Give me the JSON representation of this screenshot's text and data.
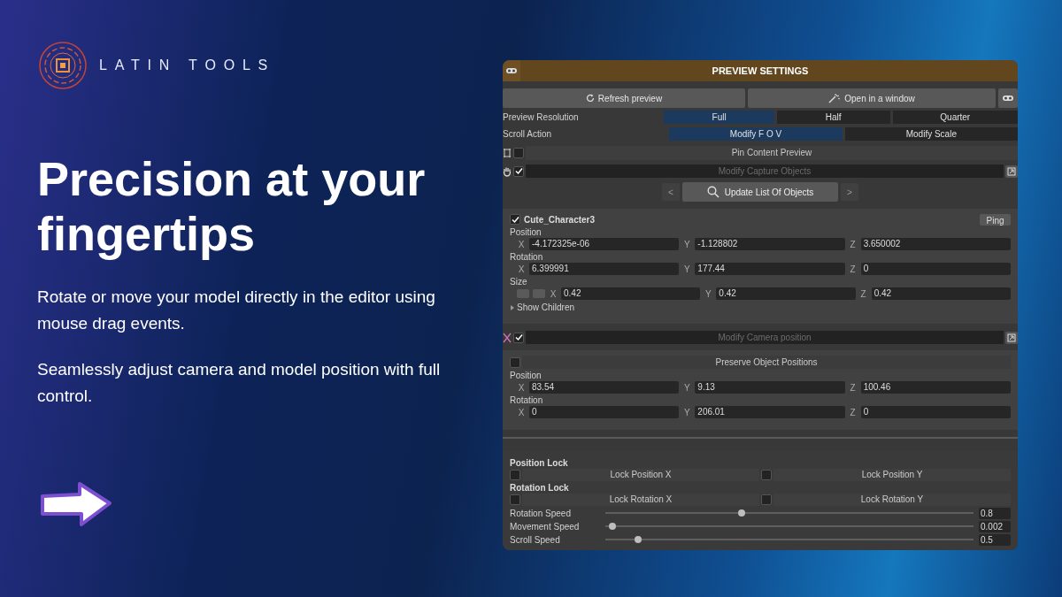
{
  "brand": "LATIN TOOLS",
  "headline": "Precision at your fingertips",
  "paragraphs": [
    "Rotate or move your model directly in the editor using mouse drag events.",
    "Seamlessly adjust camera and model position with full control."
  ],
  "panel": {
    "title": "PREVIEW SETTINGS",
    "refresh_button": "Refresh preview",
    "open_button": "Open in a window",
    "resolution": {
      "label": "Preview Resolution",
      "options": [
        {
          "label": "Full",
          "selected": true
        },
        {
          "label": "Half",
          "selected": false
        },
        {
          "label": "Quarter",
          "selected": false
        }
      ]
    },
    "scroll_action": {
      "label": "Scroll Action",
      "options": [
        {
          "label": "Modify F O V",
          "selected": true
        },
        {
          "label": "Modify Scale",
          "selected": false
        }
      ]
    },
    "pin": {
      "label": "Pin Content Preview",
      "checked": false
    },
    "capture": {
      "label": "Modify Capture Objects",
      "checked": true
    },
    "nav": {
      "prev": "<",
      "button": "Update List Of Objects",
      "next": ">"
    },
    "object": {
      "name": "Cute_Character3",
      "checked": true,
      "ping": "Ping",
      "groups": [
        {
          "label": "Position",
          "fields": [
            {
              "axis": "X",
              "value": "-4.172325e-06"
            },
            {
              "axis": "Y",
              "value": "-1.128802"
            },
            {
              "axis": "Z",
              "value": "3.650002"
            }
          ]
        },
        {
          "label": "Rotation",
          "fields": [
            {
              "axis": "X",
              "value": "6.399991"
            },
            {
              "axis": "Y",
              "value": "177.44"
            },
            {
              "axis": "Z",
              "value": "0"
            }
          ]
        },
        {
          "label": "Size",
          "kind": "size",
          "fields": [
            {
              "axis": "X",
              "value": "0.42"
            },
            {
              "axis": "Y",
              "value": "0.42"
            },
            {
              "axis": "Z",
              "value": "0.42"
            }
          ]
        }
      ],
      "show_children": "Show Children"
    },
    "camera": {
      "label": "Modify Camera position",
      "checked": true,
      "preserve": {
        "label": "Preserve Object Positions",
        "checked": false
      },
      "groups": [
        {
          "label": "Position",
          "fields": [
            {
              "axis": "X",
              "value": "83.54"
            },
            {
              "axis": "Y",
              "value": "9.13"
            },
            {
              "axis": "Z",
              "value": "100.46"
            }
          ]
        },
        {
          "label": "Rotation",
          "fields": [
            {
              "axis": "X",
              "value": "0"
            },
            {
              "axis": "Y",
              "value": "206.01"
            },
            {
              "axis": "Z",
              "value": "0"
            }
          ]
        }
      ]
    },
    "locks": [
      {
        "label": "Position Lock",
        "items": [
          {
            "label": "Lock Position X",
            "checked": false
          },
          {
            "label": "Lock Position Y",
            "checked": false
          }
        ]
      },
      {
        "label": "Rotation Lock",
        "items": [
          {
            "label": "Lock Rotation X",
            "checked": false
          },
          {
            "label": "Lock Rotation Y",
            "checked": false
          }
        ]
      }
    ],
    "sliders": [
      {
        "label": "Rotation Speed",
        "level": 0.37,
        "reading": "0.8"
      },
      {
        "label": "Movement Speed",
        "level": 0.02,
        "reading": "0.002"
      },
      {
        "label": "Scroll Speed",
        "level": 0.09,
        "reading": "0.5"
      }
    ]
  }
}
